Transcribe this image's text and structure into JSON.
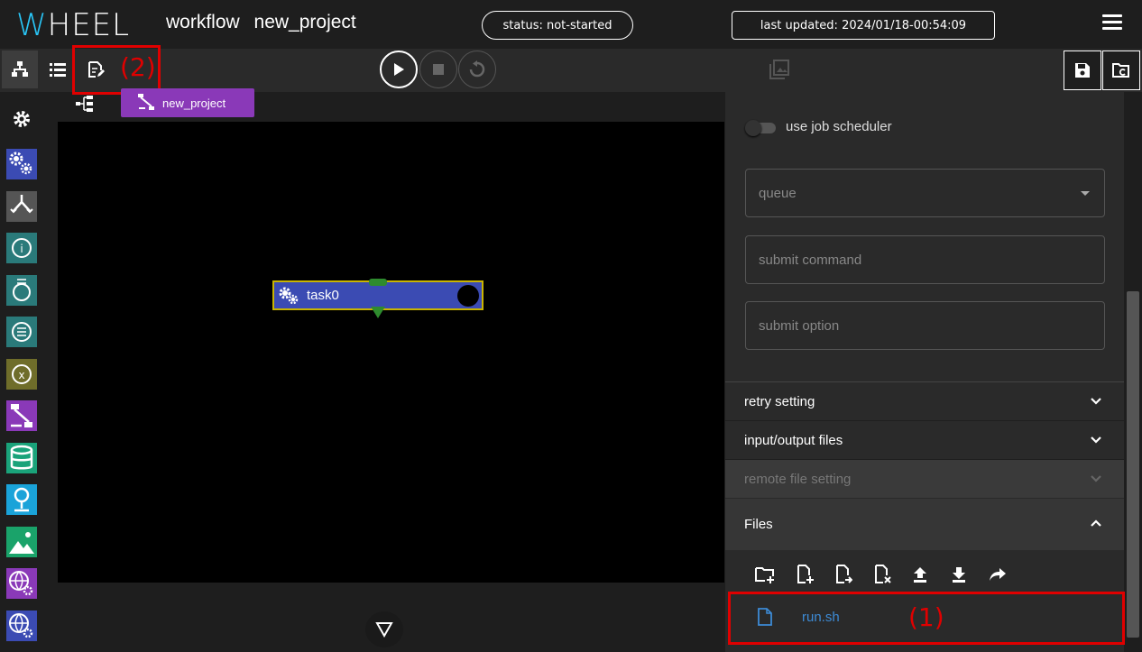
{
  "header": {
    "logo_first": "W",
    "logo_rest": "HEEL",
    "title_part1": "workflow",
    "title_part2": "new_project",
    "status": "status: not-started",
    "last_updated": "last updated: 2024/01/18-00:54:09",
    "menu_icon": "hamburger-menu-icon"
  },
  "toolbar": {
    "view_buttons": [
      "graph-view-icon",
      "list-view-icon",
      "edit-file-icon"
    ],
    "run_buttons": [
      "play-icon",
      "stop-icon",
      "reset-icon"
    ],
    "save_buttons": [
      "save-icon",
      "revert-project-icon"
    ]
  },
  "annotations": {
    "label_1": "(1)",
    "label_2": "(2)",
    "color": "#e00000"
  },
  "breadcrumb": {
    "project": "new_project",
    "color": "#8a39b8"
  },
  "components": [
    {
      "icon": "task-icon",
      "color": "#3b4bb3"
    },
    {
      "icon": "if-icon",
      "color": "#555555"
    },
    {
      "icon": "for-icon",
      "color": "#2a7a7a"
    },
    {
      "icon": "while-icon",
      "color": "#2a7a7a"
    },
    {
      "icon": "foreach-icon",
      "color": "#2a7a7a"
    },
    {
      "icon": "parameter-study-icon",
      "color": "#6f6d2a"
    },
    {
      "icon": "workflow-icon",
      "color": "#8a39b8"
    },
    {
      "icon": "storage-icon",
      "color": "#1aa37a"
    },
    {
      "icon": "source-icon",
      "color": "#1aa3d9"
    },
    {
      "icon": "viewer-icon",
      "color": "#1aa36a"
    },
    {
      "icon": "cloud-task-icon",
      "color": "#8a39b8"
    },
    {
      "icon": "bulkjob-task-icon",
      "color": "#3b4bb3"
    }
  ],
  "canvas": {
    "task_name": "task0"
  },
  "panel": {
    "use_job_scheduler": "use job scheduler",
    "queue_placeholder": "queue",
    "submit_command_placeholder": "submit command",
    "submit_option_placeholder": "submit option",
    "retry_setting": "retry setting",
    "input_output_files": "input/output files",
    "remote_file_setting": "remote file setting",
    "files": "Files",
    "file_buttons": [
      "new-folder-icon",
      "new-file-icon",
      "rename-file-icon",
      "delete-file-icon",
      "upload-icon",
      "download-icon",
      "share-icon"
    ],
    "file_list": [
      "run.sh"
    ]
  }
}
